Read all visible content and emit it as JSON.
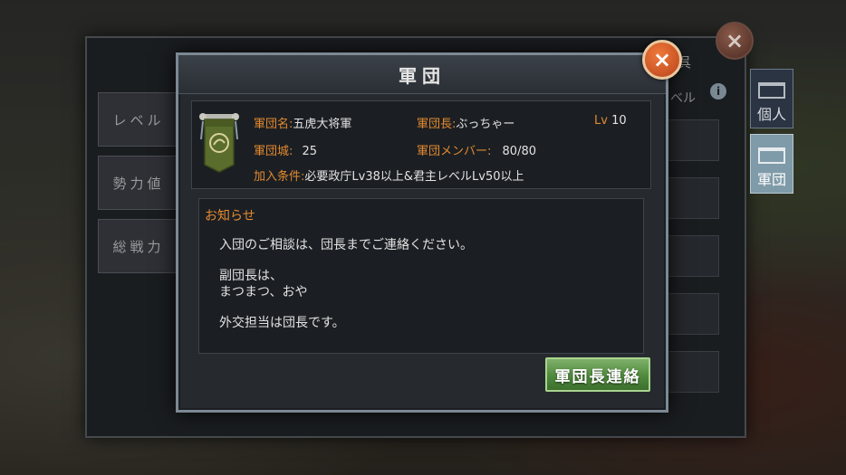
{
  "background_panel": {
    "header_text": "呉",
    "column_header": "ベル",
    "left_tabs": [
      "レベル",
      "勢力値",
      "総戦力"
    ],
    "right_tabs": [
      {
        "label": "個人",
        "active": false
      },
      {
        "label": "軍団",
        "active": true
      }
    ],
    "info_icon": "i"
  },
  "dialog": {
    "title": "軍団",
    "close_glyph": "×",
    "emblem_icon": "legion-banner-icon",
    "legion": {
      "name_label": "軍団名:",
      "name_value": "五虎大将軍",
      "leader_label": "軍団長:",
      "leader_value": "ぶっちゃー",
      "level_label": "Lv",
      "level_value": "10",
      "castle_label": "軍団城:",
      "castle_value": "25",
      "members_label": "軍団メンバー:",
      "members_value": "80/80",
      "join_label": "加入条件:",
      "join_value": "必要政庁Lv38以上&君主レベルLv50以上"
    },
    "notice": {
      "title": "お知らせ",
      "lines": [
        "入団のご相談は、団長までご連絡ください。",
        "副団長は、",
        "まつまつ、おや",
        "外交担当は団長です。"
      ]
    },
    "contact_button": "軍団長連絡"
  },
  "colors": {
    "label_orange": "#e3892f",
    "button_green": "#4f8a3d",
    "close_orange": "#d85a26"
  }
}
